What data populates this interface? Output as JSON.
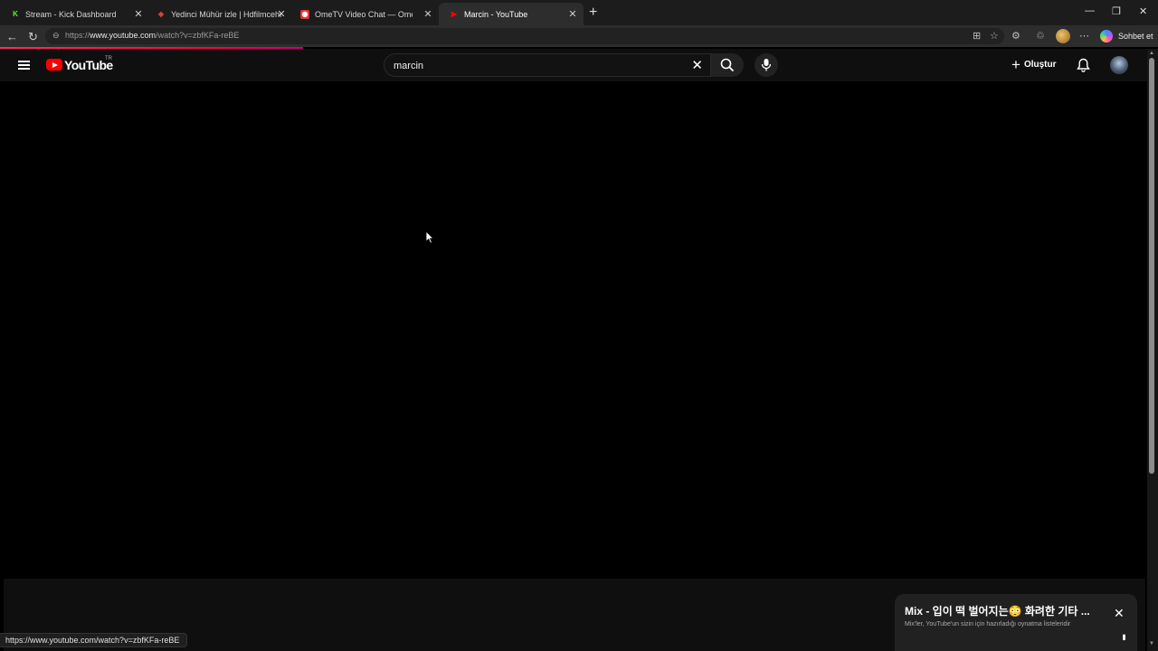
{
  "browser": {
    "tabs": [
      {
        "label": "Stream - Kick Dashboard",
        "favicon": "K",
        "favicon_color": "#53fc18",
        "active": false
      },
      {
        "label": "Yedinci Mühür izle | Hdfilmcehenn",
        "favicon": "◈",
        "favicon_color": "#e0453a",
        "active": false
      },
      {
        "label": "OmeTV Video Chat — Omegl",
        "favicon": "◉",
        "favicon_color": "#ffffff",
        "active": false
      },
      {
        "label": "Marcin - YouTube",
        "favicon": "▶",
        "favicon_color": "#ff0000",
        "active": true
      }
    ],
    "address": {
      "prefix": "https://",
      "host": "www.youtube.com",
      "path": "/watch?v=zbfKFa-reBE"
    },
    "copilot_label": "Sohbet et"
  },
  "youtube": {
    "logo_text": "YouTube",
    "country_code": "TR",
    "search_value": "marcin",
    "create_label": "Oluştur"
  },
  "miniplayer": {
    "title": "Mix - 입이 떡 벌어지는😳 화려한 기타 ...",
    "subtitle": "Mix'ler, YouTube'un sizin için hazırladığı oynatma listeleridir"
  },
  "status_url": "https://www.youtube.com/watch?v=zbfKFa-reBE",
  "colors": {
    "brand": "#ff0000",
    "background": "#000000",
    "header": "#0f0f0f"
  }
}
